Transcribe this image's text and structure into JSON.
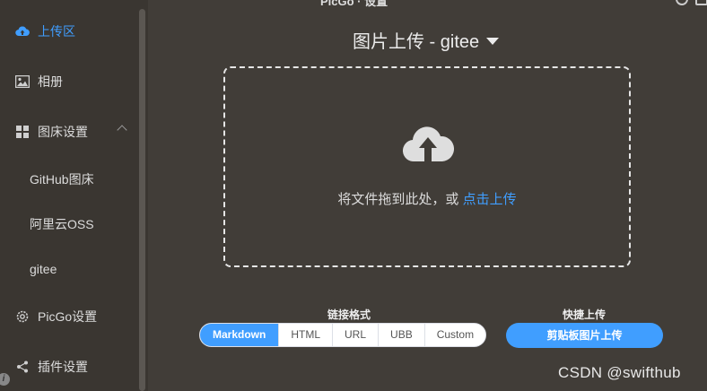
{
  "window": {
    "title_fragment": "PicGo · 设置"
  },
  "sidebar": {
    "items": [
      {
        "label": "上传区",
        "icon": "upload-cloud-icon",
        "active": true
      },
      {
        "label": "相册",
        "icon": "image-icon"
      },
      {
        "label": "图床设置",
        "icon": "grid-icon"
      },
      {
        "label": "PicGo设置",
        "icon": "gear-icon"
      },
      {
        "label": "插件设置",
        "icon": "share-icon"
      }
    ],
    "sub_items": [
      {
        "label": "GitHub图床"
      },
      {
        "label": "阿里云OSS"
      },
      {
        "label": "gitee"
      }
    ]
  },
  "main": {
    "title": "图片上传 - gitee",
    "drop_text": "将文件拖到此处，或 ",
    "drop_link": "点击上传",
    "link_format_label": "链接格式",
    "formats": [
      "Markdown",
      "HTML",
      "URL",
      "UBB",
      "Custom"
    ],
    "selected_format": "Markdown",
    "quick_upload_label": "快捷上传",
    "clipboard_button": "剪贴板图片上传"
  },
  "watermark": "CSDN @swifthub",
  "colors": {
    "accent": "#409eff",
    "background": "#413d38",
    "sidebar": "#3a3631"
  }
}
